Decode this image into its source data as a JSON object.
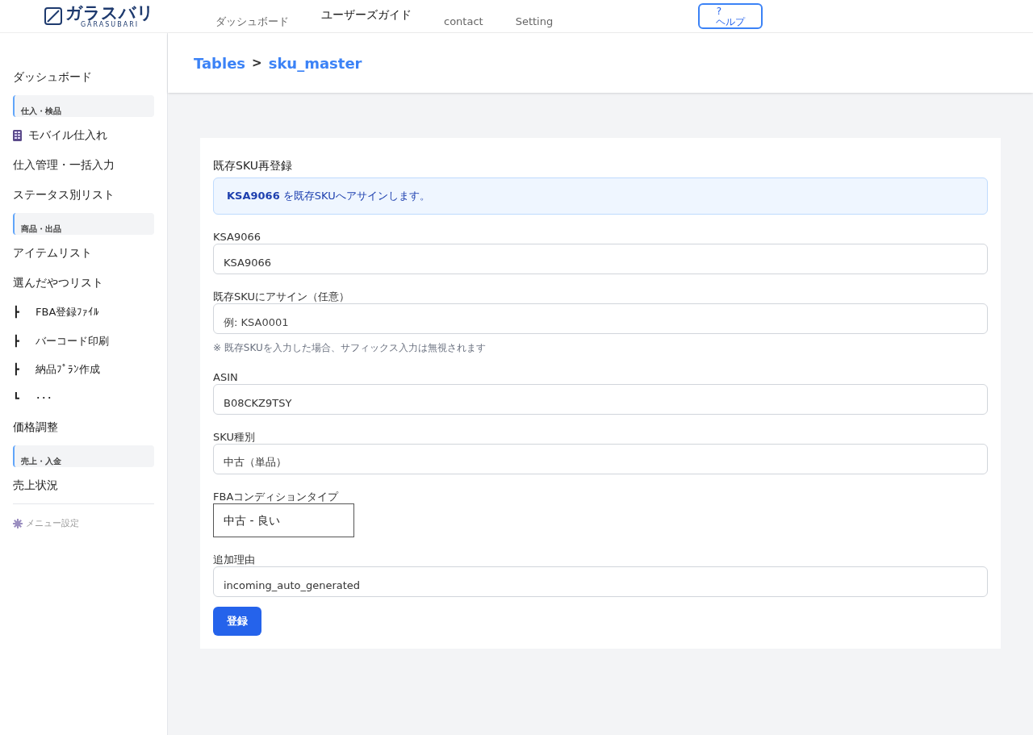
{
  "header": {
    "logo_text": "ガラスバリ",
    "logo_sub": "GARASUBARI",
    "nav": [
      {
        "label": "ダッシュボード",
        "kind": "small"
      },
      {
        "label": "ユーザーズガイド",
        "kind": "large"
      },
      {
        "label": "contact",
        "kind": "small"
      },
      {
        "label": "Setting",
        "kind": "small"
      }
    ],
    "help": {
      "mark": "?",
      "label": "ヘルプ"
    }
  },
  "sidebar": {
    "items": [
      {
        "kind": "link",
        "label": "ダッシュボード"
      },
      {
        "kind": "section",
        "label": "仕入・検品"
      },
      {
        "kind": "icon_link",
        "label": "モバイル仕入れ"
      },
      {
        "kind": "link",
        "label": "仕入管理・一括入力"
      },
      {
        "kind": "link",
        "label": "ステータス別リスト"
      },
      {
        "kind": "section",
        "label": "商品・出品"
      },
      {
        "kind": "link",
        "label": "アイテムリスト"
      },
      {
        "kind": "link",
        "label": "選んだやつリスト"
      },
      {
        "kind": "child",
        "mark": "┣",
        "label": "FBA登録ﾌｧｲﾙ"
      },
      {
        "kind": "child",
        "mark": "┣",
        "label": "バーコード印刷"
      },
      {
        "kind": "child",
        "mark": "┣",
        "label": "納品ﾌﾟﾗﾝ作成"
      },
      {
        "kind": "child",
        "mark": "┗",
        "label": "･･･"
      },
      {
        "kind": "link",
        "label": "価格調整"
      },
      {
        "kind": "section",
        "label": "売上・入金"
      },
      {
        "kind": "link",
        "label": "売上状況"
      }
    ],
    "settings": "メニュー設定"
  },
  "breadcrumb": {
    "root": "Tables",
    "separator": ">",
    "current": "sku_master"
  },
  "form": {
    "title": "既存SKU再登録",
    "notice": "**KSA9066** を既存SKUへアサインします。",
    "fields": [
      {
        "kind": "input",
        "label": "KSA9066",
        "value": "KSA9066"
      },
      {
        "kind": "input",
        "label": "既存SKUにアサイン（任意）",
        "placeholder": "例: KSA0001",
        "hint": "※ 既存SKUを入力した場合、サフィックス入力は無視されます"
      },
      {
        "kind": "input",
        "label": "ASIN",
        "value": "B08CKZ9TSY"
      },
      {
        "kind": "input",
        "label": "SKU種別",
        "value": "中古（単品）"
      },
      {
        "kind": "select",
        "label": "FBAコンディションタイプ",
        "value": "中古 - 良い"
      },
      {
        "kind": "input",
        "label": "追加理由",
        "value": "incoming_auto_generated"
      }
    ],
    "submit": "登録"
  }
}
